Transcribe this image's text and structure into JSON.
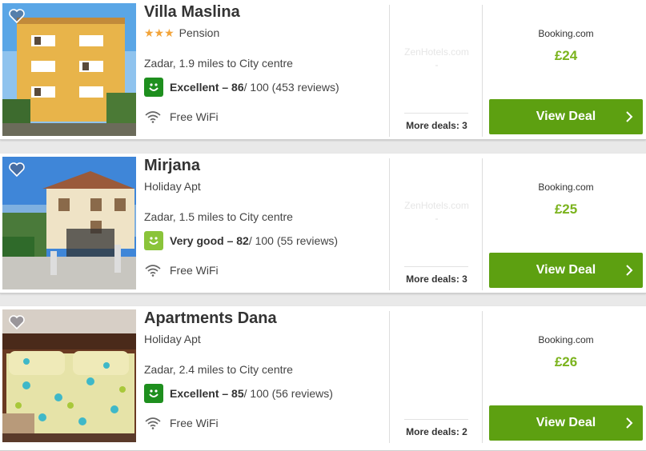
{
  "colors": {
    "accent_green": "#5da011",
    "price_green": "#7bb31d",
    "stars": "#f2a43a",
    "smiley_dark": "#1e8f1e",
    "smiley_light": "#8ac43a"
  },
  "hotels": [
    {
      "name": "Villa Maslina",
      "stars": "★★★",
      "type": "Pension",
      "location": "Zadar, 1.9 miles to City centre",
      "rating_label": "Excellent – 86",
      "rating_suffix": " / 100 (453 reviews)",
      "amenity": "Free WiFi",
      "partner": "ZenHotels.com",
      "partner_price": "-",
      "more_deals": "More deals: 3",
      "provider": "Booking.com",
      "price": "£24",
      "deal_label": "View Deal"
    },
    {
      "name": "Mirjana",
      "stars": "",
      "type": "Holiday Apt",
      "location": "Zadar, 1.5 miles to City centre",
      "rating_label": "Very good – 82",
      "rating_suffix": " / 100 (55 reviews)",
      "amenity": "Free WiFi",
      "partner": "ZenHotels.com",
      "partner_price": "-",
      "more_deals": "More deals: 3",
      "provider": "Booking.com",
      "price": "£25",
      "deal_label": "View Deal"
    },
    {
      "name": "Apartments Dana",
      "stars": "",
      "type": "Holiday Apt",
      "location": "Zadar, 2.4 miles to City centre",
      "rating_label": "Excellent – 85",
      "rating_suffix": " / 100 (56 reviews)",
      "amenity": "Free WiFi",
      "partner": "",
      "partner_price": "",
      "more_deals": "More deals: 2",
      "provider": "Booking.com",
      "price": "£26",
      "deal_label": "View Deal"
    }
  ]
}
